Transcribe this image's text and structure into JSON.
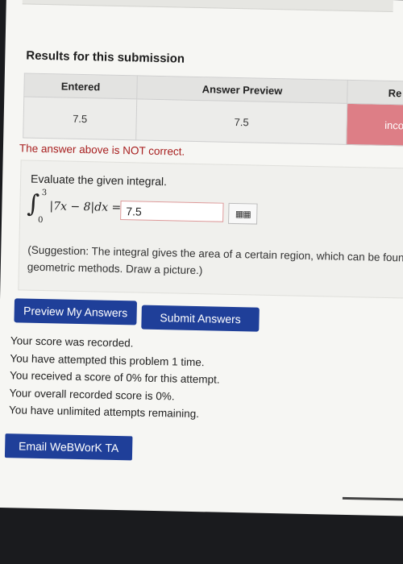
{
  "results": {
    "title": "Results for this submission",
    "headers": [
      "Entered",
      "Answer Preview",
      "Re"
    ],
    "row": [
      "7.5",
      "7.5",
      "inco"
    ],
    "status_color": "#dd7e86"
  },
  "status_message": "The answer above is NOT correct.",
  "problem": {
    "prompt": "Evaluate the given integral.",
    "integral": {
      "upper": "3",
      "lower": "0",
      "integrand": "|7x − 8|dx ="
    },
    "answer_value": "7.5",
    "equation_editor_icon": "grid-icon",
    "suggestion": "(Suggestion: The integral gives the area of a certain region, which can be foun geometric methods. Draw a picture.)"
  },
  "buttons": {
    "preview": "Preview My Answers",
    "submit": "Submit Answers",
    "email": "Email WeBWorK TA"
  },
  "score_lines": [
    "Your score was recorded.",
    "You have attempted this problem 1 time.",
    "You received a score of 0% for this attempt.",
    "Your overall recorded score is 0%.",
    "You have unlimited attempts remaining."
  ],
  "colors": {
    "button": "#1f3f99",
    "error_text": "#a82020"
  }
}
